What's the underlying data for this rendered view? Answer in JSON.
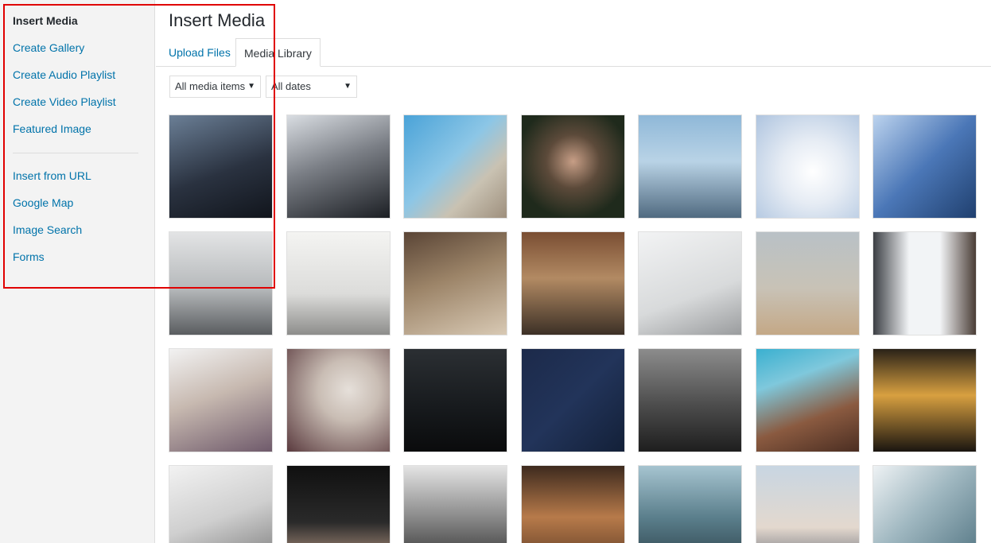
{
  "sidebar": {
    "items": [
      {
        "label": "Insert Media",
        "active": true,
        "name": "sidebar-item-insert-media"
      },
      {
        "label": "Create Gallery",
        "name": "sidebar-item-create-gallery"
      },
      {
        "label": "Create Audio Playlist",
        "name": "sidebar-item-create-audio-playlist"
      },
      {
        "label": "Create Video Playlist",
        "name": "sidebar-item-create-video-playlist"
      },
      {
        "label": "Featured Image",
        "name": "sidebar-item-featured-image"
      }
    ],
    "extra_items": [
      {
        "label": "Insert from URL",
        "name": "sidebar-item-insert-from-url"
      },
      {
        "label": "Google Map",
        "name": "sidebar-item-google-map"
      },
      {
        "label": "Image Search",
        "name": "sidebar-item-image-search"
      },
      {
        "label": "Forms",
        "name": "sidebar-item-forms"
      }
    ]
  },
  "main": {
    "title": "Insert Media",
    "tabs": {
      "upload": "Upload Files",
      "library": "Media Library"
    },
    "filters": {
      "media_type": "All media items",
      "date": "All dates"
    }
  },
  "colors": {
    "link": "#0073aa",
    "highlight_border": "#e00000",
    "sidebar_bg": "#f3f3f3"
  },
  "media_grid": {
    "thumbnails": [
      {
        "name": "thumb-people-window",
        "bg": "linear-gradient(160deg,#6b7f96 0%,#2a3240 55%,#11151c 100%)"
      },
      {
        "name": "thumb-two-men-talking",
        "bg": "linear-gradient(160deg,#d9dde2 0%,#7b7f86 45%,#1c1f24 100%)"
      },
      {
        "name": "thumb-building-sky",
        "bg": "linear-gradient(135deg,#4aa3d8 0%,#8cc6e6 45%,#c9c2b2 70%,#9e8f7d 100%)"
      },
      {
        "name": "thumb-woman-portrait",
        "bg": "radial-gradient(circle at 50% 45%,#c79e86 0%,#5c4a3a 35%,#1f2a1c 75%)"
      },
      {
        "name": "thumb-man-city",
        "bg": "linear-gradient(180deg,#8fb8d8 0%,#b9d3e6 45%,#506a80 100%)"
      },
      {
        "name": "thumb-businessman-folder",
        "bg": "radial-gradient(circle at 55% 55%,#ffffff 0%,#e6ecf4 40%,#aec4df 100%)"
      },
      {
        "name": "thumb-glass-tower",
        "bg": "linear-gradient(135deg,#bcd3ee 0%,#4b77b7 50%,#20406f 100%)"
      },
      {
        "name": "thumb-elevator",
        "bg": "linear-gradient(180deg,#e3e4e5 0%,#b6b9bb 55%,#5a5d60 100%)"
      },
      {
        "name": "thumb-white-office",
        "bg": "linear-gradient(180deg,#f4f4f2 0%,#dcdcda 60%,#8d8d8b 100%)"
      },
      {
        "name": "thumb-laptop-desk",
        "bg": "linear-gradient(160deg,#5a4536 0%,#9c8468 45%,#d8c9b4 100%)"
      },
      {
        "name": "thumb-library-hall",
        "bg": "linear-gradient(180deg,#7a4e33 0%,#b28a63 45%,#3c3026 100%)"
      },
      {
        "name": "thumb-headphones",
        "bg": "linear-gradient(160deg,#f2f3f4 0%,#d8dadb 60%,#9a9c9e 100%)"
      },
      {
        "name": "thumb-chair",
        "bg": "linear-gradient(180deg,#b9c1c6 0%,#c8c2b6 55%,#c4a886 100%)"
      },
      {
        "name": "thumb-skyscrapers-up",
        "bg": "linear-gradient(90deg,#3c3f44 0%,#f2f4f6 35%,#f2f4f6 65%,#4a3d36 100%)"
      },
      {
        "name": "thumb-woman-desk",
        "bg": "linear-gradient(160deg,#f2f2f2 0%,#c7b9b0 45%,#6f5a6b 100%)"
      },
      {
        "name": "thumb-blonde-woman",
        "bg": "radial-gradient(circle at 60% 40%,#e6e0da 0%,#c9bdb4 35%,#5a3a3e 100%)"
      },
      {
        "name": "thumb-dark-tower",
        "bg": "linear-gradient(180deg,#2b2f33 0%,#16191c 60%,#0a0b0c 100%)"
      },
      {
        "name": "thumb-navy-flatlay",
        "bg": "linear-gradient(135deg,#1c2a4a 0%,#22345a 50%,#132038 100%)"
      },
      {
        "name": "thumb-riot-police",
        "bg": "linear-gradient(180deg,#8c8c8c 0%,#4c4c4c 55%,#1e1e1e 100%)"
      },
      {
        "name": "thumb-brown-tower",
        "bg": "linear-gradient(160deg,#3ab0d0 0%,#7fc8dc 30%,#8a5a40 65%,#4b2e22 100%)"
      },
      {
        "name": "thumb-lit-windows",
        "bg": "linear-gradient(180deg,#2a2218 0%,#d8a040 45%,#1a1510 100%)"
      },
      {
        "name": "thumb-computer-screen",
        "bg": "linear-gradient(160deg,#f2f2f2 0%,#cfcfcf 50%,#7a7a7a 100%)"
      },
      {
        "name": "thumb-typing-hands",
        "bg": "linear-gradient(180deg,#101010 0%,#2a2a2a 55%,#c9a58e 100%)"
      },
      {
        "name": "thumb-couple-laughing",
        "bg": "linear-gradient(180deg,#e4e4e4 0%,#8a8a8a 50%,#2c2c2c 100%)"
      },
      {
        "name": "thumb-forest-woman",
        "bg": "linear-gradient(180deg,#3d2a1e 0%,#b77a4a 50%,#5b3a24 100%)"
      },
      {
        "name": "thumb-man-by-water",
        "bg": "linear-gradient(180deg,#a6c4d0 0%,#5b7f8c 50%,#2a3f48 100%)"
      },
      {
        "name": "thumb-city-dusk",
        "bg": "linear-gradient(180deg,#c8d6e2 0%,#e3d8ce 60%,#5e6470 100%)"
      },
      {
        "name": "thumb-glass-building",
        "bg": "linear-gradient(135deg,#eef2f4 0%,#9fb7c0 45%,#4f7280 100%)"
      }
    ]
  }
}
